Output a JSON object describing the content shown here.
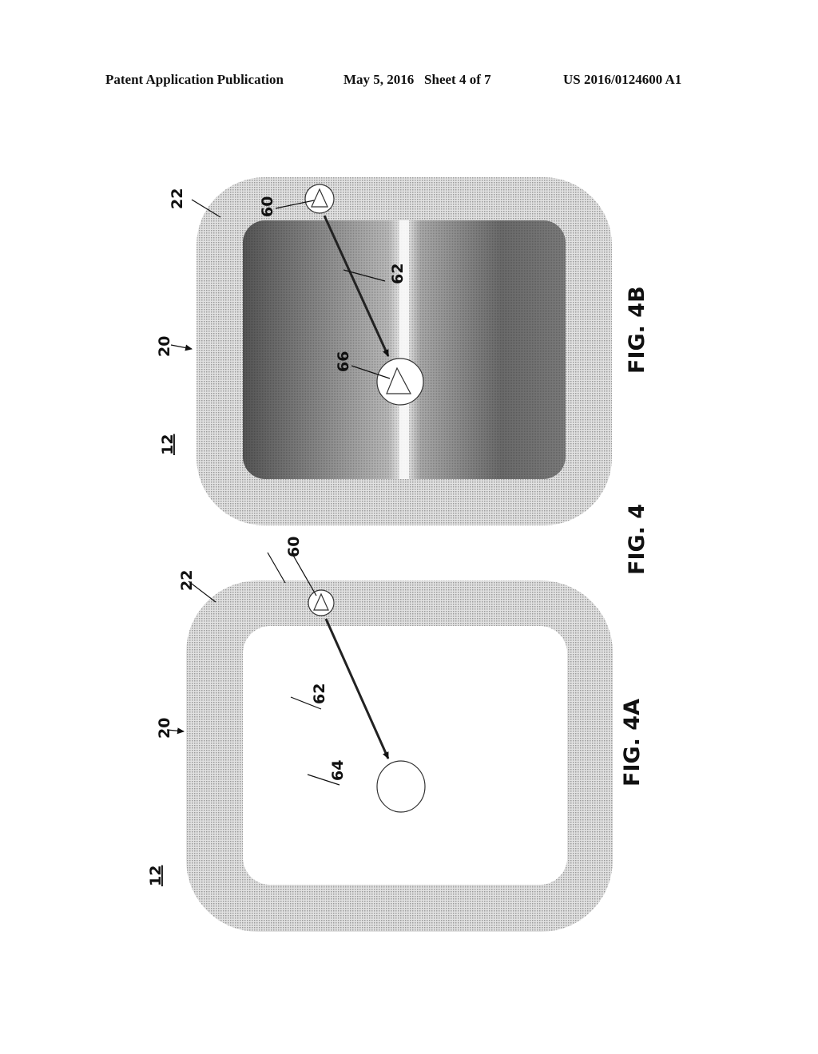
{
  "header": {
    "publication": "Patent Application Publication",
    "date_sheet": "May 5, 2016   Sheet 4 of 7",
    "number": "US 2016/0124600 A1"
  },
  "figures": {
    "fig4_label": "FIG. 4",
    "fig4a": {
      "caption": "FIG. 4A",
      "ref_device": "12",
      "ref_display": "20",
      "ref_border": "22",
      "ref_start_marker": "60",
      "ref_path": "62",
      "ref_target": "64"
    },
    "fig4b": {
      "caption": "FIG. 4B",
      "ref_device": "12",
      "ref_display": "20",
      "ref_border": "22",
      "ref_start_marker": "60",
      "ref_path": "62",
      "ref_target_marker": "66"
    }
  },
  "colors": {
    "ink": "#111111",
    "border_fill": "#c9c9c9",
    "photo_dark": "#5a5a5a"
  }
}
